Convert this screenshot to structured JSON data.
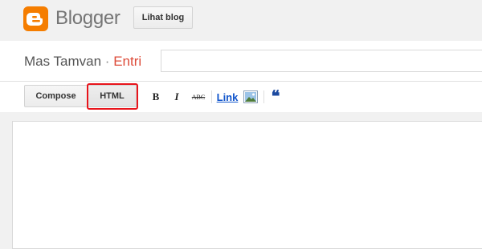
{
  "header": {
    "brand": "Blogger",
    "view_blog_label": "Lihat blog"
  },
  "post": {
    "blog_name": "Mas Tamvan",
    "separator": "·",
    "entry_label": "Entri",
    "title_value": ""
  },
  "toolbar": {
    "compose_label": "Compose",
    "html_label": "HTML",
    "bold_label": "B",
    "italic_label": "I",
    "strike_label": "ABC",
    "link_label": "Link",
    "quote_label": "❝"
  },
  "colors": {
    "brand_orange": "#f57d00",
    "entry_red": "#dd4b39",
    "highlight_red": "#e8141b",
    "link_blue": "#1155cc"
  },
  "icons": [
    "blogger-logo-icon",
    "image-icon",
    "quote-icon"
  ]
}
